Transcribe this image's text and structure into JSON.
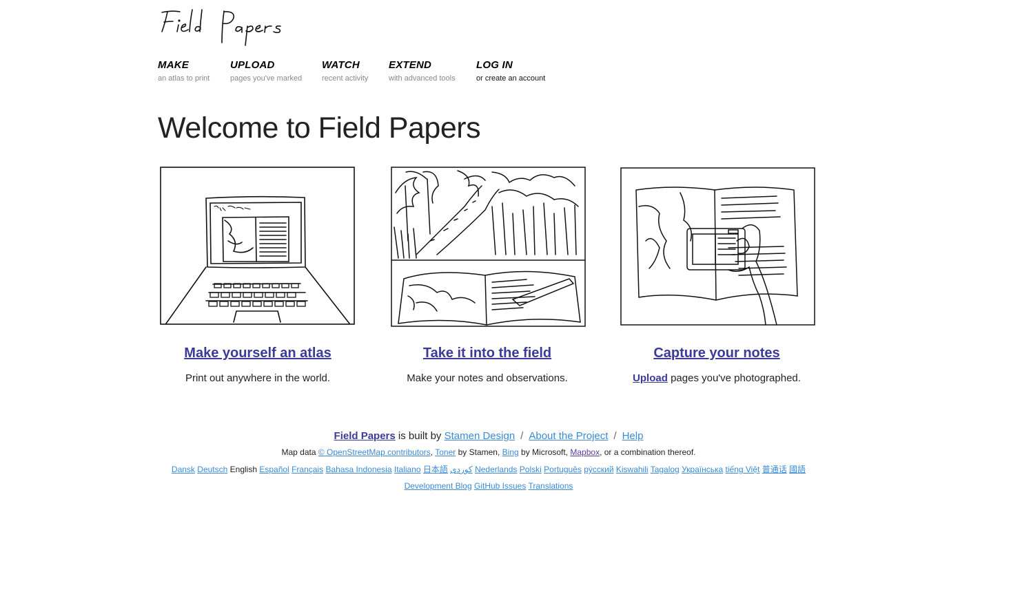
{
  "logo": {
    "text": "Field Papers"
  },
  "nav": [
    {
      "title": "MAKE",
      "sub": "an atlas to print"
    },
    {
      "title": "UPLOAD",
      "sub": "pages you've marked"
    },
    {
      "title": "WATCH",
      "sub": "recent activity"
    },
    {
      "title": "EXTEND",
      "sub": "with advanced tools"
    },
    {
      "title": "LOG IN",
      "sub": "or create an account"
    }
  ],
  "heading": "Welcome to Field Papers",
  "cards": [
    {
      "title": "Make yourself an atlas",
      "desc": "Print out anywhere in the world."
    },
    {
      "title": "Take it into the field",
      "desc": "Make your notes and observations."
    },
    {
      "title": "Capture your notes",
      "desc_link": "Upload",
      "desc": " pages you've photographed."
    }
  ],
  "footer": {
    "brand": "Field Papers",
    "built_by": " is built by ",
    "stamen": "Stamen Design",
    "about": "About the Project",
    "help": "Help",
    "sep": "/",
    "mapdata_prefix": "Map data ",
    "osm": "© OpenStreetMap contributors",
    "comma": ", ",
    "toner": "Toner",
    "by_stamen": " by Stamen, ",
    "bing": "Bing",
    "by_ms": " by Microsoft, ",
    "mapbox": "Mapbox",
    "combo": ", or a combination thereof.",
    "languages": [
      "Dansk",
      "Deutsch",
      "English",
      "Español",
      "Français",
      "Bahasa Indonesia",
      "Italiano",
      "日本語",
      "کوردی",
      "Nederlands",
      "Polski",
      "Português",
      "рýсский",
      "Kiswahili",
      "Tagalog",
      "Українська",
      "tiếng Việt",
      "普通话",
      "國語"
    ],
    "current_language": "English",
    "dev_blog": "Development Blog",
    "github": "GitHub Issues",
    "translations": "Translations"
  },
  "colors": {
    "link": "#3a3a9a",
    "footer_link": "#3a8ad6",
    "text": "#222222"
  }
}
